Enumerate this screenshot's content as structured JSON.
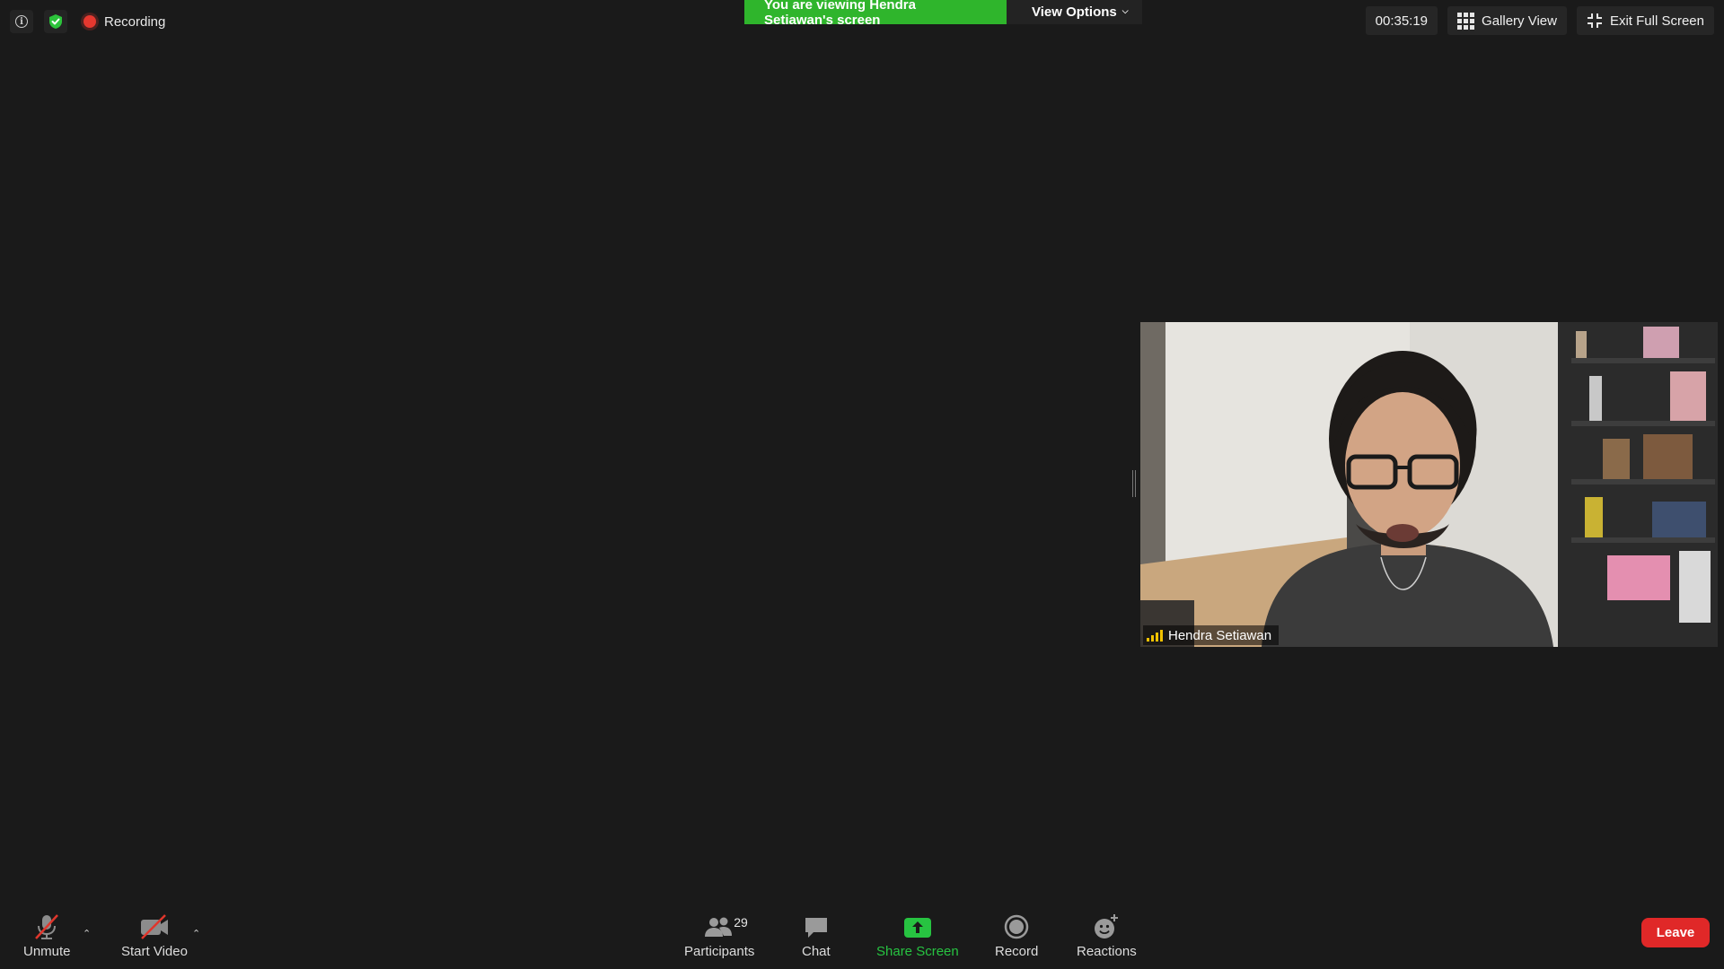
{
  "status": {
    "recording_label": "Recording"
  },
  "banner": {
    "viewing_text": "You are viewing Hendra Setiawan's screen",
    "view_options_label": "View Options"
  },
  "top_right": {
    "timer": "00:35:19",
    "gallery_view_label": "Gallery View",
    "exit_fullscreen_label": "Exit Full Screen"
  },
  "video": {
    "participant_name": "Hendra Setiawan"
  },
  "toolbar": {
    "unmute_label": "Unmute",
    "start_video_label": "Start Video",
    "participants_label": "Participants",
    "participants_count": "29",
    "chat_label": "Chat",
    "share_screen_label": "Share Screen",
    "record_label": "Record",
    "reactions_label": "Reactions",
    "leave_label": "Leave"
  },
  "colors": {
    "banner_green": "#2fb52c",
    "share_green": "#27c341",
    "leave_red": "#e02828",
    "recording_red": "#e5382f",
    "signal_yellow": "#f2c200"
  },
  "icons": {
    "info": "info-icon",
    "security": "shield-check-icon",
    "gallery": "grid-icon",
    "exit_fullscreen": "collapse-icon",
    "mic_muted": "mic-off-icon",
    "video_off": "video-off-icon",
    "participants": "people-icon",
    "chat": "chat-bubble-icon",
    "share": "share-arrow-icon",
    "record": "record-icon",
    "reactions": "smiley-plus-icon",
    "signal": "signal-bars-icon"
  }
}
